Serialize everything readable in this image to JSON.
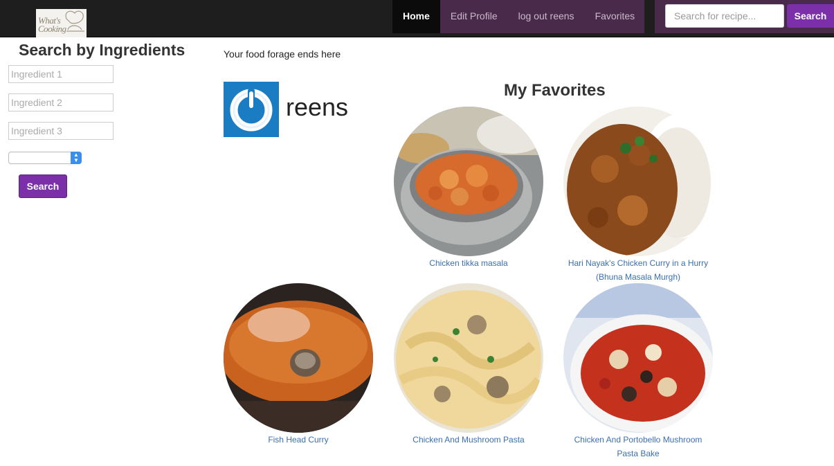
{
  "navbar": {
    "logo_alt": "What's Cooking",
    "logo_line1": "What's",
    "logo_line2": "Cooking",
    "items": [
      {
        "label": "Home",
        "active": true
      },
      {
        "label": "Edit Profile",
        "active": false
      },
      {
        "label": "log out reens",
        "active": false
      },
      {
        "label": "Favorites",
        "active": false
      }
    ],
    "search_placeholder": "Search for recipe...",
    "search_button": "Search"
  },
  "sidebar": {
    "title": "Search by Ingredients",
    "ingredients": [
      {
        "placeholder": "Ingredient 1"
      },
      {
        "placeholder": "Ingredient 2"
      },
      {
        "placeholder": "Ingredient 3"
      }
    ],
    "select_value": "",
    "search_button": "Search"
  },
  "main": {
    "tagline": "Your food forage ends here",
    "username": "reens",
    "favorites_title": "My Favorites",
    "recipes": [
      {
        "line1": "Chicken tikka masala",
        "line2": ""
      },
      {
        "line1": "Hari Nayak's Chicken Curry in a Hurry",
        "line2": "(Bhuna Masala Murgh)"
      },
      {
        "line1": "Fish Head Curry",
        "line2": ""
      },
      {
        "line1": "Chicken And Mushroom Pasta",
        "line2": ""
      },
      {
        "line1": "Chicken And Portobello Mushroom",
        "line2": "Pasta Bake"
      }
    ]
  },
  "colors": {
    "navbar_bg": "#1e1e1e",
    "menu_bg": "#4a2a4a",
    "accent_purple": "#7b2fa8",
    "link_blue": "#3a6fb0",
    "avatar_blue": "#1a7dc4"
  }
}
